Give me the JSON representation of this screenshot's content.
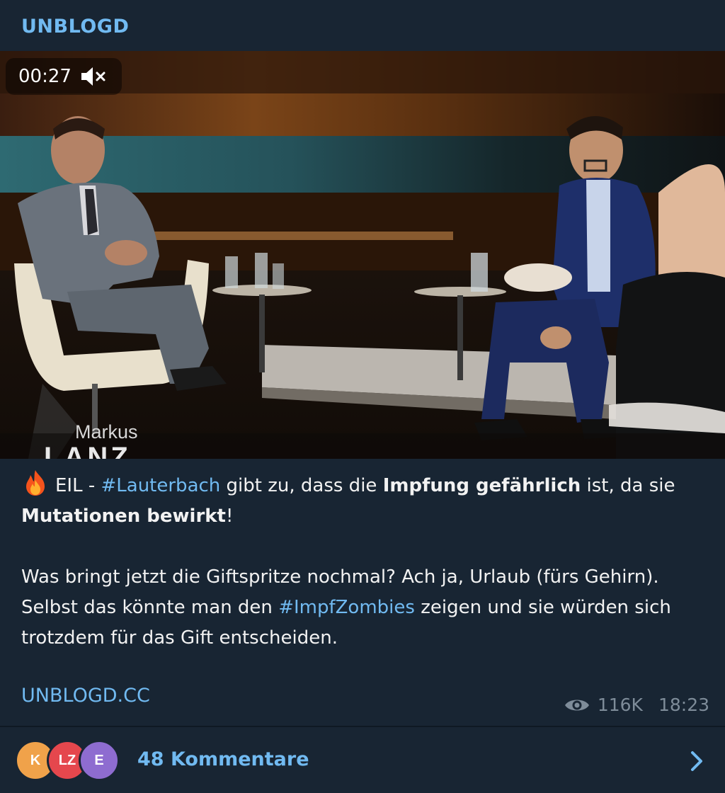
{
  "channel": {
    "name": "UNBLOGD"
  },
  "video": {
    "time": "00:27",
    "mute_icon": "speaker-muted-icon",
    "show_label_line1": "Markus",
    "show_label_line2": "LANZ"
  },
  "message": {
    "line1": {
      "emoji": "fire-icon",
      "prefix": "EIL - ",
      "hashtag1": "#Lauterbach",
      "mid1": " gibt zu, dass die ",
      "bold1": "Impfung gefährlich",
      "mid2": " ist, da sie ",
      "bold2": "Mutationen bewirkt",
      "end": "!"
    },
    "para2": {
      "text1": "Was bringt jetzt die Giftspritze nochmal? Ach ja, Urlaub (fürs Gehirn). Selbst das könnte man den ",
      "hashtag": "#ImpfZombies",
      "text2": " zeigen und sie würden sich trotzdem für das Gift entscheiden."
    }
  },
  "link": {
    "text": "UNBLOGD.CC"
  },
  "meta": {
    "views_icon": "eye-icon",
    "views": "116K",
    "time": "18:23"
  },
  "comments": {
    "avatars": [
      {
        "initials": "K",
        "color": "#f0a24a"
      },
      {
        "initials": "LZ",
        "color": "#e5474d"
      },
      {
        "initials": "E",
        "color": "#8e6cd0"
      }
    ],
    "label": "48 Kommentare",
    "chevron_icon": "chevron-right-icon"
  },
  "colors": {
    "accent": "#71baf1",
    "background": "#182533",
    "meta": "#7e8c99"
  }
}
